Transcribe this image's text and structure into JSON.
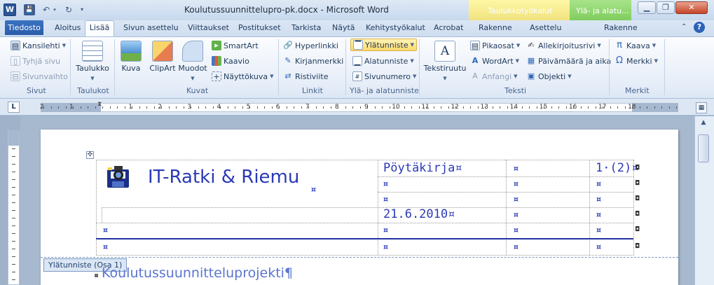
{
  "window": {
    "title": "Koulutussuunnittelupro-pk.docx - Microsoft Word",
    "app_icon": "W",
    "ctx_table_label": "Taulukkotyökalut",
    "ctx_hf_label": "Ylä- ja alatu...",
    "min": "▁",
    "max": "❐",
    "close": "✕"
  },
  "qat": {
    "save": "💾",
    "undo": "↶",
    "undo_drop": "▾",
    "redo": "↻",
    "custom": "▾"
  },
  "tabs": {
    "file": "Tiedosto",
    "home": "Aloitus",
    "insert": "Lisää",
    "layout": "Sivun asettelu",
    "refs": "Viittaukset",
    "mailings": "Postitukset",
    "review": "Tarkista",
    "view": "Näytä",
    "dev": "Kehitystyökalut",
    "acrobat": "Acrobat",
    "design": "Rakenne",
    "tbl_layout": "Asettelu",
    "hf_design": "Rakenne"
  },
  "ribbon": {
    "pages": {
      "cover": "Kansilehti",
      "blank": "Tyhjä sivu",
      "break": "Sivunvaihto",
      "label": "Sivut"
    },
    "tables": {
      "table": "Taulukko",
      "label": "Taulukot"
    },
    "illus": {
      "picture": "Kuva",
      "clipart": "ClipArt",
      "shapes": "Muodot",
      "smartart": "SmartArt",
      "chart": "Kaavio",
      "screenshot": "Näyttökuva",
      "label": "Kuvat"
    },
    "links": {
      "hyperlink": "Hyperlinkki",
      "bookmark": "Kirjanmerkki",
      "crossref": "Ristiviite",
      "label": "Linkit"
    },
    "hf": {
      "header": "Ylätunniste",
      "footer": "Alatunniste",
      "pagenum": "Sivunumero",
      "label": "Ylä- ja alatunniste"
    },
    "text": {
      "textbox": "Tekstiruutu",
      "quickparts": "Pikaosat",
      "wordart": "WordArt",
      "dropcap": "Anfangi",
      "sigline": "Allekirjoitusrivi",
      "datetime": "Päivämäärä ja aika",
      "object": "Objekti",
      "label": "Teksti"
    },
    "symbols": {
      "equation": "Kaava",
      "symbol": "Merkki",
      "label": "Merkit"
    }
  },
  "ruler": {
    "numbers": [
      "2",
      "1",
      "1",
      "2",
      "3",
      "4",
      "5",
      "6",
      "7",
      "8",
      "9",
      "10",
      "11",
      "12",
      "13",
      "14",
      "15",
      "16",
      "17",
      "18"
    ]
  },
  "document": {
    "company": "IT-Ratki & Riemu",
    "doc_type": "Pöytäkirja¤",
    "page_num": "1·(2)¤",
    "date": "21.6.2010¤",
    "cell_mark": "¤",
    "header_tag": "Ylätunniste (Osa 1)",
    "body_heading": "Koulutussuunnitteluprojekti¶"
  },
  "colors": {
    "accent": "#2b5797",
    "text_blue": "#2a39b6",
    "heading_blue": "#5a74d0",
    "rule_line": "#2431a0"
  }
}
